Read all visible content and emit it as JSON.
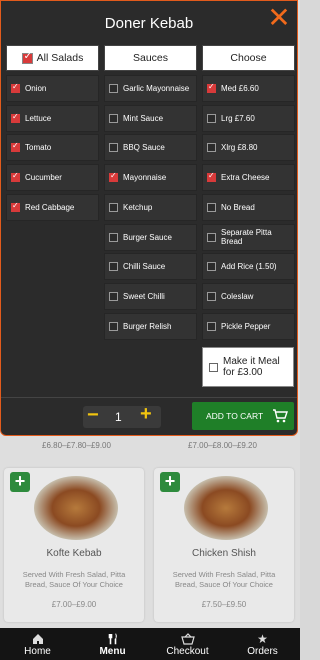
{
  "modal": {
    "title": "Doner Kebab",
    "columns": {
      "salads": {
        "header": "All Salads",
        "options": [
          {
            "label": "Onion",
            "checked": true
          },
          {
            "label": "Lettuce",
            "checked": true
          },
          {
            "label": "Tomato",
            "checked": true
          },
          {
            "label": "Cucumber",
            "checked": true
          },
          {
            "label": "Red Cabbage",
            "checked": true
          }
        ]
      },
      "sauces": {
        "header": "Sauces",
        "options": [
          {
            "label": "Garlic Mayonnaise",
            "checked": false
          },
          {
            "label": "Mint Sauce",
            "checked": false
          },
          {
            "label": "BBQ Sauce",
            "checked": false
          },
          {
            "label": "Mayonnaise",
            "checked": true
          },
          {
            "label": "Ketchup",
            "checked": false
          },
          {
            "label": "Burger Sauce",
            "checked": false
          },
          {
            "label": "Chilli Sauce",
            "checked": false
          },
          {
            "label": "Sweet Chilli",
            "checked": false
          },
          {
            "label": "Burger Relish",
            "checked": false
          }
        ]
      },
      "choose": {
        "header": "Choose",
        "options": [
          {
            "label": "Med £6.60",
            "checked": true
          },
          {
            "label": "Lrg £7.60",
            "checked": false
          },
          {
            "label": "Xlrg £8.80",
            "checked": false
          },
          {
            "label": "Extra Cheese",
            "checked": true
          },
          {
            "label": "No Bread",
            "checked": false
          },
          {
            "label": "Separate Pitta Bread",
            "checked": false
          },
          {
            "label": "Add Rice (1.50)",
            "checked": false
          },
          {
            "label": "Coleslaw",
            "checked": false
          },
          {
            "label": "Pickle Pepper",
            "checked": false
          }
        ]
      }
    },
    "meal": {
      "line1": "Make it Meal",
      "line2": "for £3.00",
      "checked": false
    },
    "quantity": "1",
    "add_to_cart_label": "ADD TO CART",
    "colors": {
      "accent": "#e25b1c",
      "check": "#d83a3a",
      "add_button": "#1f7f28",
      "qty_icons": "#f1c40f"
    }
  },
  "background": {
    "price_row": {
      "left": "£6.80–£7.80–£9.00",
      "right": "£7.00–£8.00–£9.20"
    },
    "cards": [
      {
        "name": "Kofte Kebab",
        "description": "Served With Fresh Salad, Pitta Bread, Sauce Of Your Choice",
        "price": "£7.00–£9.00"
      },
      {
        "name": "Chicken Shish",
        "description": "Served With Fresh Salad, Pitta Bread, Sauce Of Your Choice",
        "price": "£7.50–£9.50"
      }
    ]
  },
  "nav": {
    "items": [
      {
        "label": "Home",
        "icon": "home-icon"
      },
      {
        "label": "Menu",
        "icon": "cutlery-icon"
      },
      {
        "label": "Checkout",
        "icon": "basket-icon"
      },
      {
        "label": "Orders",
        "icon": "star-icon"
      }
    ]
  }
}
